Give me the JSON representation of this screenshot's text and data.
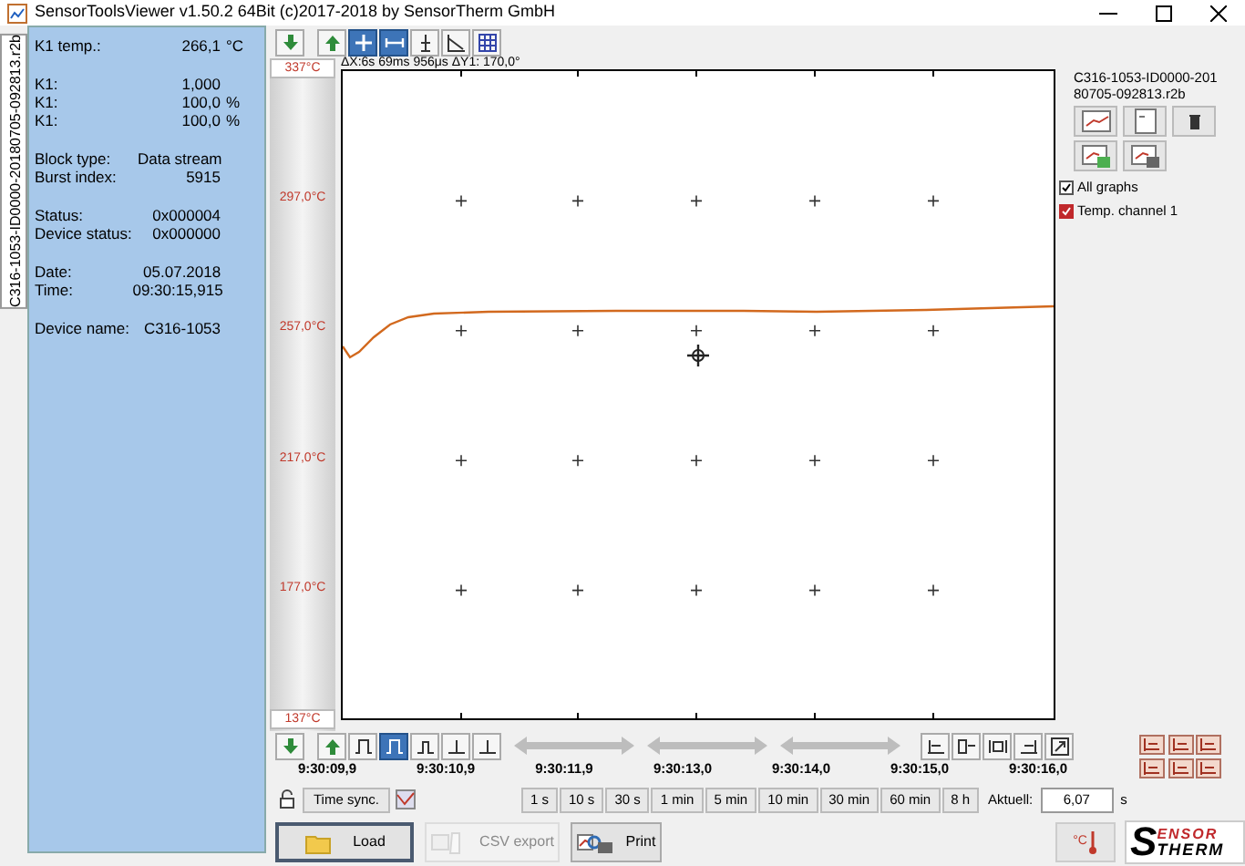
{
  "window": {
    "title": "SensorToolsViewer v1.50.2 64Bit (c)2017-2018 by SensorTherm GmbH"
  },
  "file_tab": {
    "label": "C316-1053-ID0000-20180705-092813.r2b"
  },
  "info_panel": {
    "groups": [
      [
        {
          "label": "K1 temp.:",
          "value": "266,1",
          "unit": "°C"
        }
      ],
      [
        {
          "label": "K1:",
          "value": "1,000"
        },
        {
          "label": "K1:",
          "value": "100,0",
          "unit": "%"
        },
        {
          "label": "K1:",
          "value": "100,0",
          "unit": "%"
        }
      ],
      [
        {
          "label": "Block type:",
          "value": "Data stream"
        },
        {
          "label": "Burst index:",
          "value": "5915"
        }
      ],
      [
        {
          "label": "Status:",
          "value": "0x000004"
        },
        {
          "label": "Device status:",
          "value": "0x000000"
        }
      ],
      [
        {
          "label": "Date:",
          "value": "05.07.2018"
        },
        {
          "label": "Time:",
          "value": "09:30:15,915"
        }
      ],
      [
        {
          "label": "Device name:",
          "value": "C316-1053"
        }
      ]
    ]
  },
  "top_toolbar": {
    "buttons": [
      {
        "kind": "down",
        "selected": false
      },
      {
        "kind": "up",
        "selected": false
      },
      {
        "kind": "cross",
        "selected": true
      },
      {
        "kind": "span",
        "selected": true
      },
      {
        "kind": "ybar",
        "selected": false
      },
      {
        "kind": "slope",
        "selected": false
      },
      {
        "kind": "grid",
        "selected": false
      }
    ]
  },
  "cursor_readout": "ΔX:6s 69ms 956μs ΔY1: 170,0°",
  "y_scale": {
    "labels": [
      "337°C",
      "297,0°C",
      "257,0°C",
      "217,0°C",
      "177,0°C",
      "137°C"
    ]
  },
  "time_axis": {
    "labels": [
      "9:30:09,9",
      "9:30:10,9",
      "9:30:11,9",
      "9:30:13,0",
      "9:30:14,0",
      "9:30:15,0",
      "9:30:16,0"
    ]
  },
  "file_panel": {
    "filename": "C316-1053-ID0000-20180705-092813.r2b",
    "checkboxes": [
      {
        "label": "All graphs",
        "checked": true
      },
      {
        "label": "Temp. channel 1",
        "checked": true,
        "color": "#c0282b"
      }
    ]
  },
  "bottom_toolbar": {
    "buttons": [
      {
        "kind": "down",
        "selected": false
      },
      {
        "kind": "up",
        "selected": false
      },
      {
        "kind": "pulsewide",
        "selected": false
      },
      {
        "kind": "pulse",
        "selected": true
      },
      {
        "kind": "pulsenarrow",
        "selected": false
      },
      {
        "kind": "step",
        "selected": false
      },
      {
        "kind": "step",
        "selected": false
      }
    ],
    "nav": [
      {
        "kind": "start"
      },
      {
        "kind": "zoomin"
      },
      {
        "kind": "fit"
      },
      {
        "kind": "end"
      },
      {
        "kind": "expand"
      }
    ]
  },
  "time_sync": {
    "label": "Time sync."
  },
  "ranges": [
    {
      "label": "1 s"
    },
    {
      "label": "10 s"
    },
    {
      "label": "30 s"
    },
    {
      "label": "1 min"
    },
    {
      "label": "5 min"
    },
    {
      "label": "10 min"
    },
    {
      "label": "30 min"
    },
    {
      "label": "60 min"
    },
    {
      "label": "8 h"
    }
  ],
  "current": {
    "label": "Aktuell:",
    "value": "6,07",
    "unit": "s"
  },
  "actions": [
    {
      "kind": "load",
      "label": "Load",
      "disabled": false
    },
    {
      "kind": "csv",
      "label": "CSV export",
      "disabled": true
    },
    {
      "kind": "print",
      "label": "Print",
      "disabled": false
    }
  ],
  "unit_button": {
    "label": "°C"
  },
  "logo": {
    "initial": "S",
    "top": "ENSOR",
    "bottom": "THERM"
  }
}
